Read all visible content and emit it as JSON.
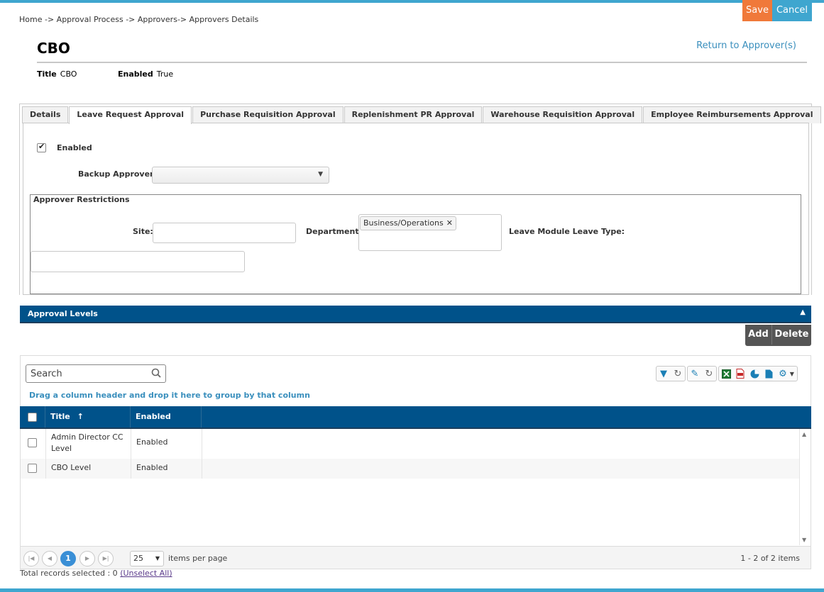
{
  "actions": {
    "save": "Save",
    "cancel": "Cancel"
  },
  "breadcrumb": {
    "home": "Home",
    "sep1": " -> ",
    "approval_process": "Approval Process",
    "sep2": " -> ",
    "approvers": "Approvers",
    "sep3": "-> ",
    "details": "Approvers Details"
  },
  "page": {
    "title": "CBO",
    "return_link": "Return to Approver(s)",
    "meta": {
      "title_label": "Title",
      "title_value": "CBO",
      "enabled_label": "Enabled",
      "enabled_value": "True"
    }
  },
  "tabs": [
    {
      "label": "Details",
      "active": false
    },
    {
      "label": "Leave Request Approval",
      "active": true
    },
    {
      "label": "Purchase Requisition Approval",
      "active": false
    },
    {
      "label": "Replenishment PR Approval",
      "active": false
    },
    {
      "label": "Warehouse Requisition Approval",
      "active": false
    },
    {
      "label": "Employee Reimbursements Approval",
      "active": false
    }
  ],
  "form": {
    "enabled_label": "Enabled",
    "enabled_checked": true,
    "backup_approver_label": "Backup Approver:",
    "backup_approver_value": "",
    "restrictions_legend": "Approver Restrictions",
    "site_label": "Site:",
    "site_value": "",
    "department_label": "Department:",
    "department_selected": [
      "Business/Operations"
    ],
    "leave_type_label": "Leave Module Leave Type:",
    "leave_type_value": ""
  },
  "approval_levels": {
    "title": "Approval Levels",
    "add": "Add",
    "delete": "Delete",
    "search_placeholder": "Search",
    "group_hint": "Drag a column header and drop it here to group by that column",
    "columns": {
      "title": "Title",
      "title_sort": "↑",
      "enabled": "Enabled"
    },
    "rows": [
      {
        "title": "Admin Director CC Level",
        "enabled": "Enabled"
      },
      {
        "title": "CBO Level",
        "enabled": "Enabled"
      }
    ],
    "pager": {
      "current_page": "1",
      "page_size": "25",
      "items_per_page": "items per page",
      "summary": "1 - 2 of 2 items"
    },
    "footer": {
      "selected_text": "Total records selected : 0 ",
      "unselect": "(Unselect All)"
    }
  },
  "colors": {
    "accent": "#3fa6cf",
    "save": "#f0793a",
    "header_blue": "#00528a",
    "link": "#3a8fbd"
  }
}
